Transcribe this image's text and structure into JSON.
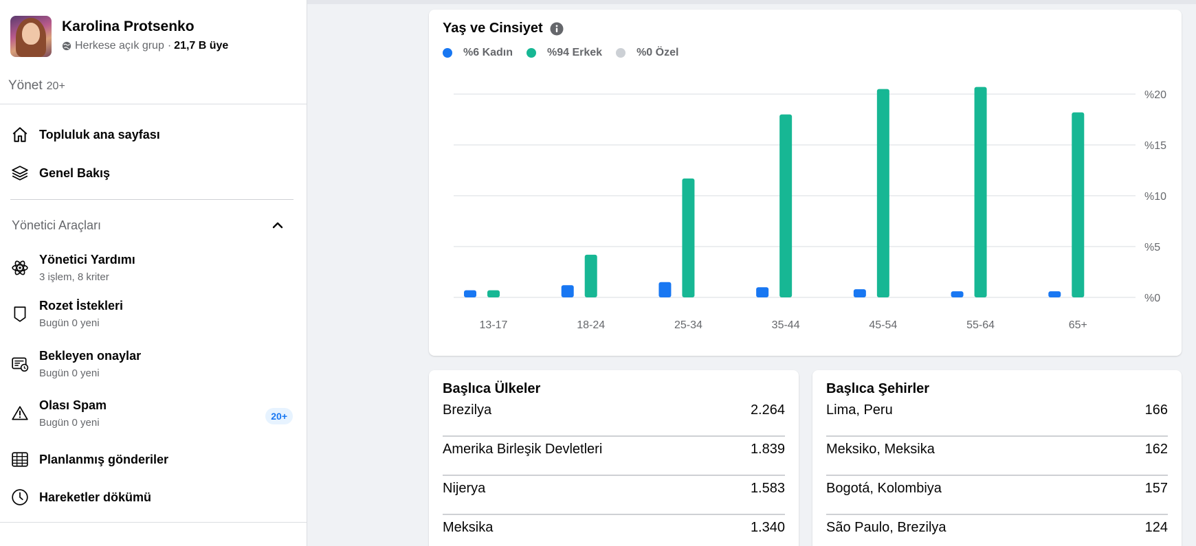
{
  "group": {
    "name": "Karolina Protsenko",
    "privacy": "Herkese açık grup",
    "separator": "·",
    "members": "21,7 B üye"
  },
  "sidebar": {
    "manage_label": "Yönet",
    "manage_count": "20+",
    "items": [
      {
        "label": "Topluluk ana sayfası",
        "icon": "home-icon"
      },
      {
        "label": "Genel Bakış",
        "icon": "layers-icon"
      }
    ],
    "admin_tools_title": "Yönetici Araçları",
    "admin_tools": [
      {
        "label": "Yönetici Yardımı",
        "sub": "3 işlem, 8 kriter",
        "icon": "atom-icon"
      },
      {
        "label": "Rozet İstekleri",
        "sub": "Bugün 0 yeni",
        "icon": "badge-icon"
      },
      {
        "label": "Bekleyen onaylar",
        "sub": "Bugün 0 yeni",
        "icon": "pending-icon"
      },
      {
        "label": "Olası Spam",
        "sub": "Bugün 0 yeni",
        "icon": "warning-icon",
        "badge": "20+"
      },
      {
        "label": "Planlanmış gönderiler",
        "icon": "calendar-icon"
      },
      {
        "label": "Hareketler dökümü",
        "icon": "clock-icon"
      }
    ]
  },
  "chart_data": {
    "type": "bar",
    "title": "Yaş ve Cinsiyet",
    "categories": [
      "13-17",
      "18-24",
      "25-34",
      "35-44",
      "45-54",
      "55-64",
      "65+"
    ],
    "series": [
      {
        "name": "%6 Kadın",
        "color": "#1877f2",
        "values": [
          0.7,
          1.2,
          1.5,
          1.0,
          0.8,
          0.6,
          0.6
        ]
      },
      {
        "name": "%94 Erkek",
        "color": "#17b794",
        "values": [
          0.7,
          4.2,
          11.7,
          18.0,
          20.5,
          20.7,
          18.2
        ]
      },
      {
        "name": "%0 Özel",
        "color": "#ccd0d5",
        "values": [
          0,
          0,
          0,
          0,
          0,
          0,
          0
        ]
      }
    ],
    "y_ticks": [
      "%0",
      "%5",
      "%10",
      "%15",
      "%20"
    ],
    "y_tick_values": [
      0,
      5,
      10,
      15,
      20
    ],
    "ylim": [
      0,
      20
    ],
    "grid": true,
    "legend_position": "top-left"
  },
  "top_countries": {
    "title": "Başlıca Ülkeler",
    "rows": [
      {
        "name": "Brezilya",
        "value": "2.264"
      },
      {
        "name": "Amerika Birleşik Devletleri",
        "value": "1.839"
      },
      {
        "name": "Nijerya",
        "value": "1.583"
      },
      {
        "name": "Meksika",
        "value": "1.340"
      }
    ]
  },
  "top_cities": {
    "title": "Başlıca Şehirler",
    "rows": [
      {
        "name": "Lima, Peru",
        "value": "166"
      },
      {
        "name": "Meksiko, Meksika",
        "value": "162"
      },
      {
        "name": "Bogotá, Kolombiya",
        "value": "157"
      },
      {
        "name": "São Paulo, Brezilya",
        "value": "124"
      }
    ]
  }
}
